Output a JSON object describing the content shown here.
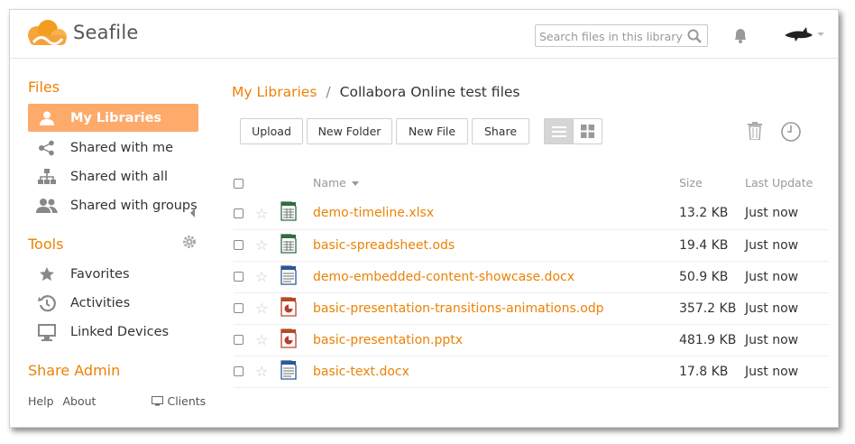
{
  "header": {
    "logo_text": "Seafile",
    "search_placeholder": "Search files in this library"
  },
  "sidebar": {
    "files_heading": "Files",
    "files_items": [
      {
        "label": "My Libraries",
        "icon": "user-icon",
        "active": true
      },
      {
        "label": "Shared with me",
        "icon": "share-icon"
      },
      {
        "label": "Shared with all",
        "icon": "org-icon"
      },
      {
        "label": "Shared with groups",
        "icon": "group-icon"
      }
    ],
    "tools_heading": "Tools",
    "tools_items": [
      {
        "label": "Favorites",
        "icon": "star-icon"
      },
      {
        "label": "Activities",
        "icon": "history-icon"
      },
      {
        "label": "Linked Devices",
        "icon": "monitor-icon"
      }
    ],
    "share_admin_heading": "Share Admin",
    "footer": {
      "help": "Help",
      "about": "About",
      "clients": "Clients"
    }
  },
  "breadcrumb": {
    "root": "My Libraries",
    "separator": "/",
    "current": "Collabora Online test files"
  },
  "toolbar": {
    "upload": "Upload",
    "new_folder": "New Folder",
    "new_file": "New File",
    "share": "Share"
  },
  "table": {
    "headers": {
      "name": "Name",
      "size": "Size",
      "last_update": "Last Update"
    },
    "rows": [
      {
        "name": "demo-timeline.xlsx",
        "type": "spreadsheet",
        "size": "13.2 KB",
        "updated": "Just now"
      },
      {
        "name": "basic-spreadsheet.ods",
        "type": "spreadsheet",
        "size": "19.4 KB",
        "updated": "Just now"
      },
      {
        "name": "demo-embedded-content-showcase.docx",
        "type": "document",
        "size": "50.9 KB",
        "updated": "Just now"
      },
      {
        "name": "basic-presentation-transitions-animations.odp",
        "type": "presentation",
        "size": "357.2 KB",
        "updated": "Just now"
      },
      {
        "name": "basic-presentation.pptx",
        "type": "presentation",
        "size": "481.9 KB",
        "updated": "Just now"
      },
      {
        "name": "basic-text.docx",
        "type": "document",
        "size": "17.8 KB",
        "updated": "Just now"
      }
    ]
  },
  "colors": {
    "accent": "#eb8205",
    "active_bg": "#fdaa6b"
  }
}
